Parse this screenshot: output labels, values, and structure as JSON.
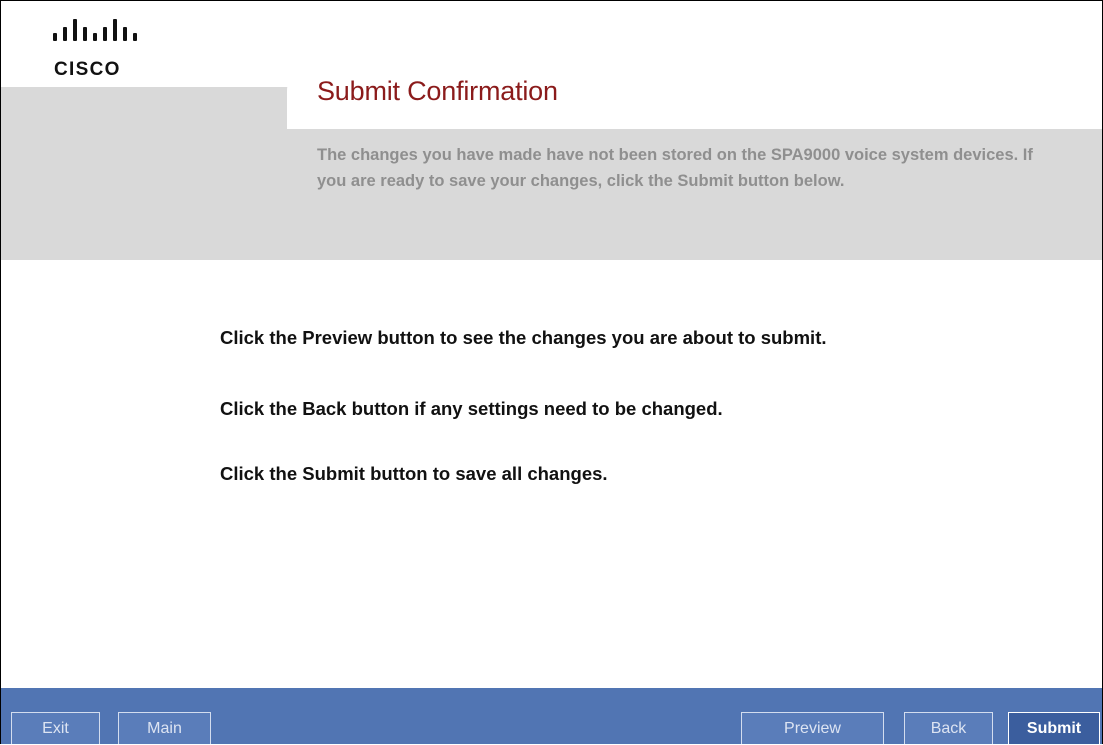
{
  "brand": {
    "logo_text": "CISCO",
    "logo_icon": "cisco-bars-logo"
  },
  "page": {
    "title": "Submit Confirmation",
    "subtitle": "The changes you have made have not been stored on the SPA9000 voice system devices. If you are ready to save your changes, click the Submit button below."
  },
  "instructions": [
    "Click the Preview button to see the changes you are about to submit.",
    "Click the Back button if any settings need to be changed.",
    "Click the Submit button to save all changes."
  ],
  "footer": {
    "exit_label": "Exit",
    "main_label": "Main",
    "preview_label": "Preview",
    "back_label": "Back",
    "submit_label": "Submit"
  },
  "colors": {
    "title": "#8b1b1b",
    "header_gray": "#d9d9d9",
    "footer_blue": "#5175b3"
  }
}
